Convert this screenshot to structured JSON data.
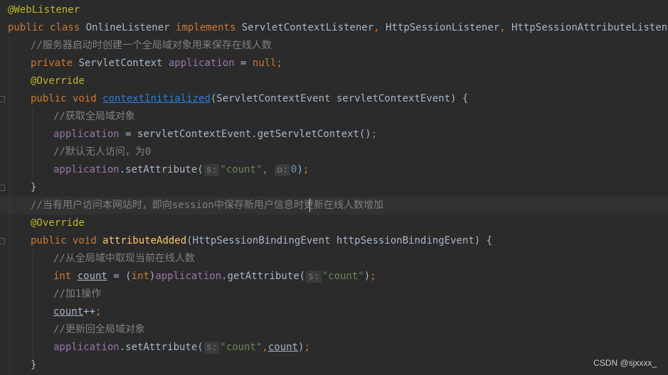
{
  "editor": {
    "lines": [
      {
        "indent": 0,
        "tokens": [
          [
            "ann",
            "@WebListener"
          ]
        ]
      },
      {
        "indent": 0,
        "tokens": [
          [
            "kw",
            "public class "
          ],
          [
            "plain",
            "OnlineListener "
          ],
          [
            "kw",
            "implements "
          ],
          [
            "plain",
            "ServletContextListener"
          ],
          [
            "kw",
            ", "
          ],
          [
            "plain",
            "HttpSessionListener"
          ],
          [
            "kw",
            ", "
          ],
          [
            "plain",
            "HttpSessionAttributeListener {"
          ]
        ]
      },
      {
        "indent": 1,
        "tokens": [
          [
            "cmt",
            "//服务器启动时创建一个全局域对象用来保存在线人数"
          ]
        ]
      },
      {
        "indent": 1,
        "tokens": [
          [
            "kw",
            "private "
          ],
          [
            "plain",
            "ServletContext "
          ],
          [
            "field",
            "application "
          ],
          [
            "plain",
            "= "
          ],
          [
            "kw",
            "null;"
          ]
        ]
      },
      {
        "indent": 1,
        "tokens": [
          [
            "ann",
            "@Override"
          ]
        ]
      },
      {
        "indent": 1,
        "fold": true,
        "tokens": [
          [
            "kw",
            "public void "
          ],
          [
            "method-link",
            "contextInitialized"
          ],
          [
            "plain",
            "(ServletContextEvent servletContextEvent) {"
          ]
        ]
      },
      {
        "indent": 2,
        "tokens": [
          [
            "cmt",
            "//获取全局域对象"
          ]
        ]
      },
      {
        "indent": 2,
        "tokens": [
          [
            "field",
            "application "
          ],
          [
            "plain",
            "= servletContextEvent.getServletContext()"
          ],
          [
            "kw",
            ";"
          ]
        ]
      },
      {
        "indent": 2,
        "tokens": [
          [
            "cmt",
            "//默认无人访问，为0"
          ]
        ]
      },
      {
        "indent": 2,
        "tokens": [
          [
            "field",
            "application"
          ],
          [
            "plain",
            ".setAttribute("
          ],
          [
            "hint",
            "s:"
          ],
          [
            "str",
            "\"count\""
          ],
          [
            "kw",
            ", "
          ],
          [
            "hint",
            "o:"
          ],
          [
            "num",
            "0"
          ],
          [
            "plain",
            ")"
          ],
          [
            "kw",
            ";"
          ]
        ]
      },
      {
        "indent": 1,
        "fold": true,
        "tokens": [
          [
            "plain",
            "}"
          ]
        ]
      },
      {
        "indent": 1,
        "current": true,
        "caret": true,
        "tokens": [
          [
            "cmt",
            "//当有用户访问本网站时，即向session中保存新用户信息时更新在线人数增加"
          ]
        ]
      },
      {
        "indent": 1,
        "tokens": [
          [
            "ann",
            "@Override"
          ]
        ]
      },
      {
        "indent": 1,
        "fold": true,
        "tokens": [
          [
            "kw",
            "public void "
          ],
          [
            "method-decl",
            "attributeAdded"
          ],
          [
            "plain",
            "(HttpSessionBindingEvent httpSessionBindingEvent) {"
          ]
        ]
      },
      {
        "indent": 2,
        "tokens": [
          [
            "cmt",
            "//从全局域中取现当前在线人数"
          ]
        ]
      },
      {
        "indent": 2,
        "tokens": [
          [
            "kw",
            "int "
          ],
          [
            "ul",
            "count"
          ],
          [
            "plain",
            " = ("
          ],
          [
            "kw",
            "int"
          ],
          [
            "plain",
            ")"
          ],
          [
            "field",
            "application"
          ],
          [
            "plain",
            ".getAttribute("
          ],
          [
            "hint",
            "s:"
          ],
          [
            "str",
            "\"count\""
          ],
          [
            "plain",
            ")"
          ],
          [
            "kw",
            ";"
          ]
        ]
      },
      {
        "indent": 2,
        "tokens": [
          [
            "cmt",
            "//加1操作"
          ]
        ]
      },
      {
        "indent": 2,
        "tokens": [
          [
            "ul",
            "count"
          ],
          [
            "plain",
            "++"
          ],
          [
            "kw",
            ";"
          ]
        ]
      },
      {
        "indent": 2,
        "tokens": [
          [
            "cmt",
            "//更新回全局域对象"
          ]
        ]
      },
      {
        "indent": 2,
        "tokens": [
          [
            "field",
            "application"
          ],
          [
            "plain",
            ".setAttribute("
          ],
          [
            "hint",
            "s:"
          ],
          [
            "str",
            "\"count\""
          ],
          [
            "kw",
            ","
          ],
          [
            "ul",
            "count"
          ],
          [
            "plain",
            ")"
          ],
          [
            "kw",
            ";"
          ]
        ]
      },
      {
        "indent": 1,
        "tokens": [
          [
            "plain",
            "}"
          ]
        ]
      }
    ]
  },
  "watermark": "CSDN @sjxxxx_"
}
